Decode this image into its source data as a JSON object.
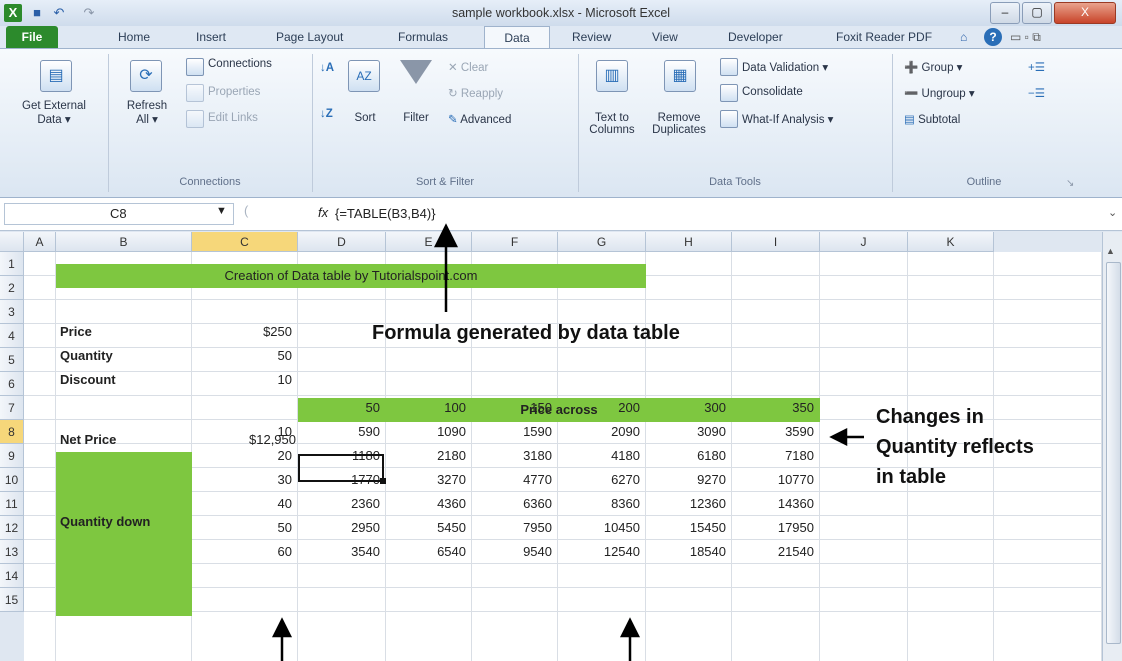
{
  "window": {
    "title": "sample workbook.xlsx - Microsoft Excel",
    "controls": [
      "–",
      "▢",
      "X"
    ]
  },
  "tabs": [
    "File",
    "Home",
    "Insert",
    "Page Layout",
    "Formulas",
    "Data",
    "Review",
    "View",
    "Developer",
    "Foxit Reader PDF"
  ],
  "active_tab": "Data",
  "ribbon": {
    "get_external_data": [
      "Get External",
      "Data ▾"
    ],
    "refresh": [
      "Refresh",
      "All ▾"
    ],
    "connections": "Connections",
    "properties": "Properties",
    "edit_links": "Edit Links",
    "group_connections": "Connections",
    "sort": "Sort",
    "filter": "Filter",
    "clear": "Clear",
    "reapply": "Reapply",
    "advanced": "Advanced",
    "group_sort_filter": "Sort & Filter",
    "text_to_columns": [
      "Text to",
      "Columns"
    ],
    "remove_duplicates": [
      "Remove",
      "Duplicates"
    ],
    "data_validation": "Data Validation ▾",
    "consolidate": "Consolidate",
    "what_if": "What-If Analysis ▾",
    "group_data_tools": "Data Tools",
    "group": "Group ▾",
    "ungroup": "Ungroup ▾",
    "subtotal": "Subtotal",
    "group_outline": "Outline"
  },
  "formula_bar": {
    "name_box": "C8",
    "fx": "fx",
    "formula": "{=TABLE(B3,B4)}"
  },
  "columns": [
    "A",
    "B",
    "C",
    "D",
    "E",
    "F",
    "G",
    "H",
    "I",
    "J",
    "K"
  ],
  "rows": [
    "1",
    "2",
    "3",
    "4",
    "5",
    "6",
    "7",
    "8",
    "9",
    "10",
    "11",
    "12",
    "13",
    "14",
    "15"
  ],
  "sheet": {
    "title": "Creation of Data table by Tutorialspoint.com",
    "price_label": "Price",
    "price": "$250",
    "quantity_label": "Quantity",
    "quantity": "50",
    "discount_label": "Discount",
    "discount": "10",
    "price_across": "Price across",
    "net_price_label": "Net Price",
    "net_price": "$12,950",
    "price_headers": [
      "50",
      "100",
      "150",
      "200",
      "300",
      "350"
    ],
    "quantity_down_label": "Quantity down",
    "table_rows": [
      {
        "q": "10",
        "v": [
          "590",
          "1090",
          "1590",
          "2090",
          "3090",
          "3590"
        ]
      },
      {
        "q": "20",
        "v": [
          "1180",
          "2180",
          "3180",
          "4180",
          "6180",
          "7180"
        ]
      },
      {
        "q": "30",
        "v": [
          "1770",
          "3270",
          "4770",
          "6270",
          "9270",
          "10770"
        ]
      },
      {
        "q": "40",
        "v": [
          "2360",
          "4360",
          "6360",
          "8360",
          "12360",
          "14360"
        ]
      },
      {
        "q": "50",
        "v": [
          "2950",
          "5450",
          "7950",
          "10450",
          "15450",
          "17950"
        ]
      },
      {
        "q": "60",
        "v": [
          "3540",
          "6540",
          "9540",
          "12540",
          "18540",
          "21540"
        ]
      }
    ]
  },
  "annotations": {
    "formula_note": "Formula generated by data table",
    "changes_note": [
      "Changes in",
      "Quantity reflects",
      "in table"
    ]
  },
  "colors": {
    "green_fill": "#7ec740",
    "file_tab": "#2c8a2c",
    "selected_header": "#f6d77a"
  }
}
